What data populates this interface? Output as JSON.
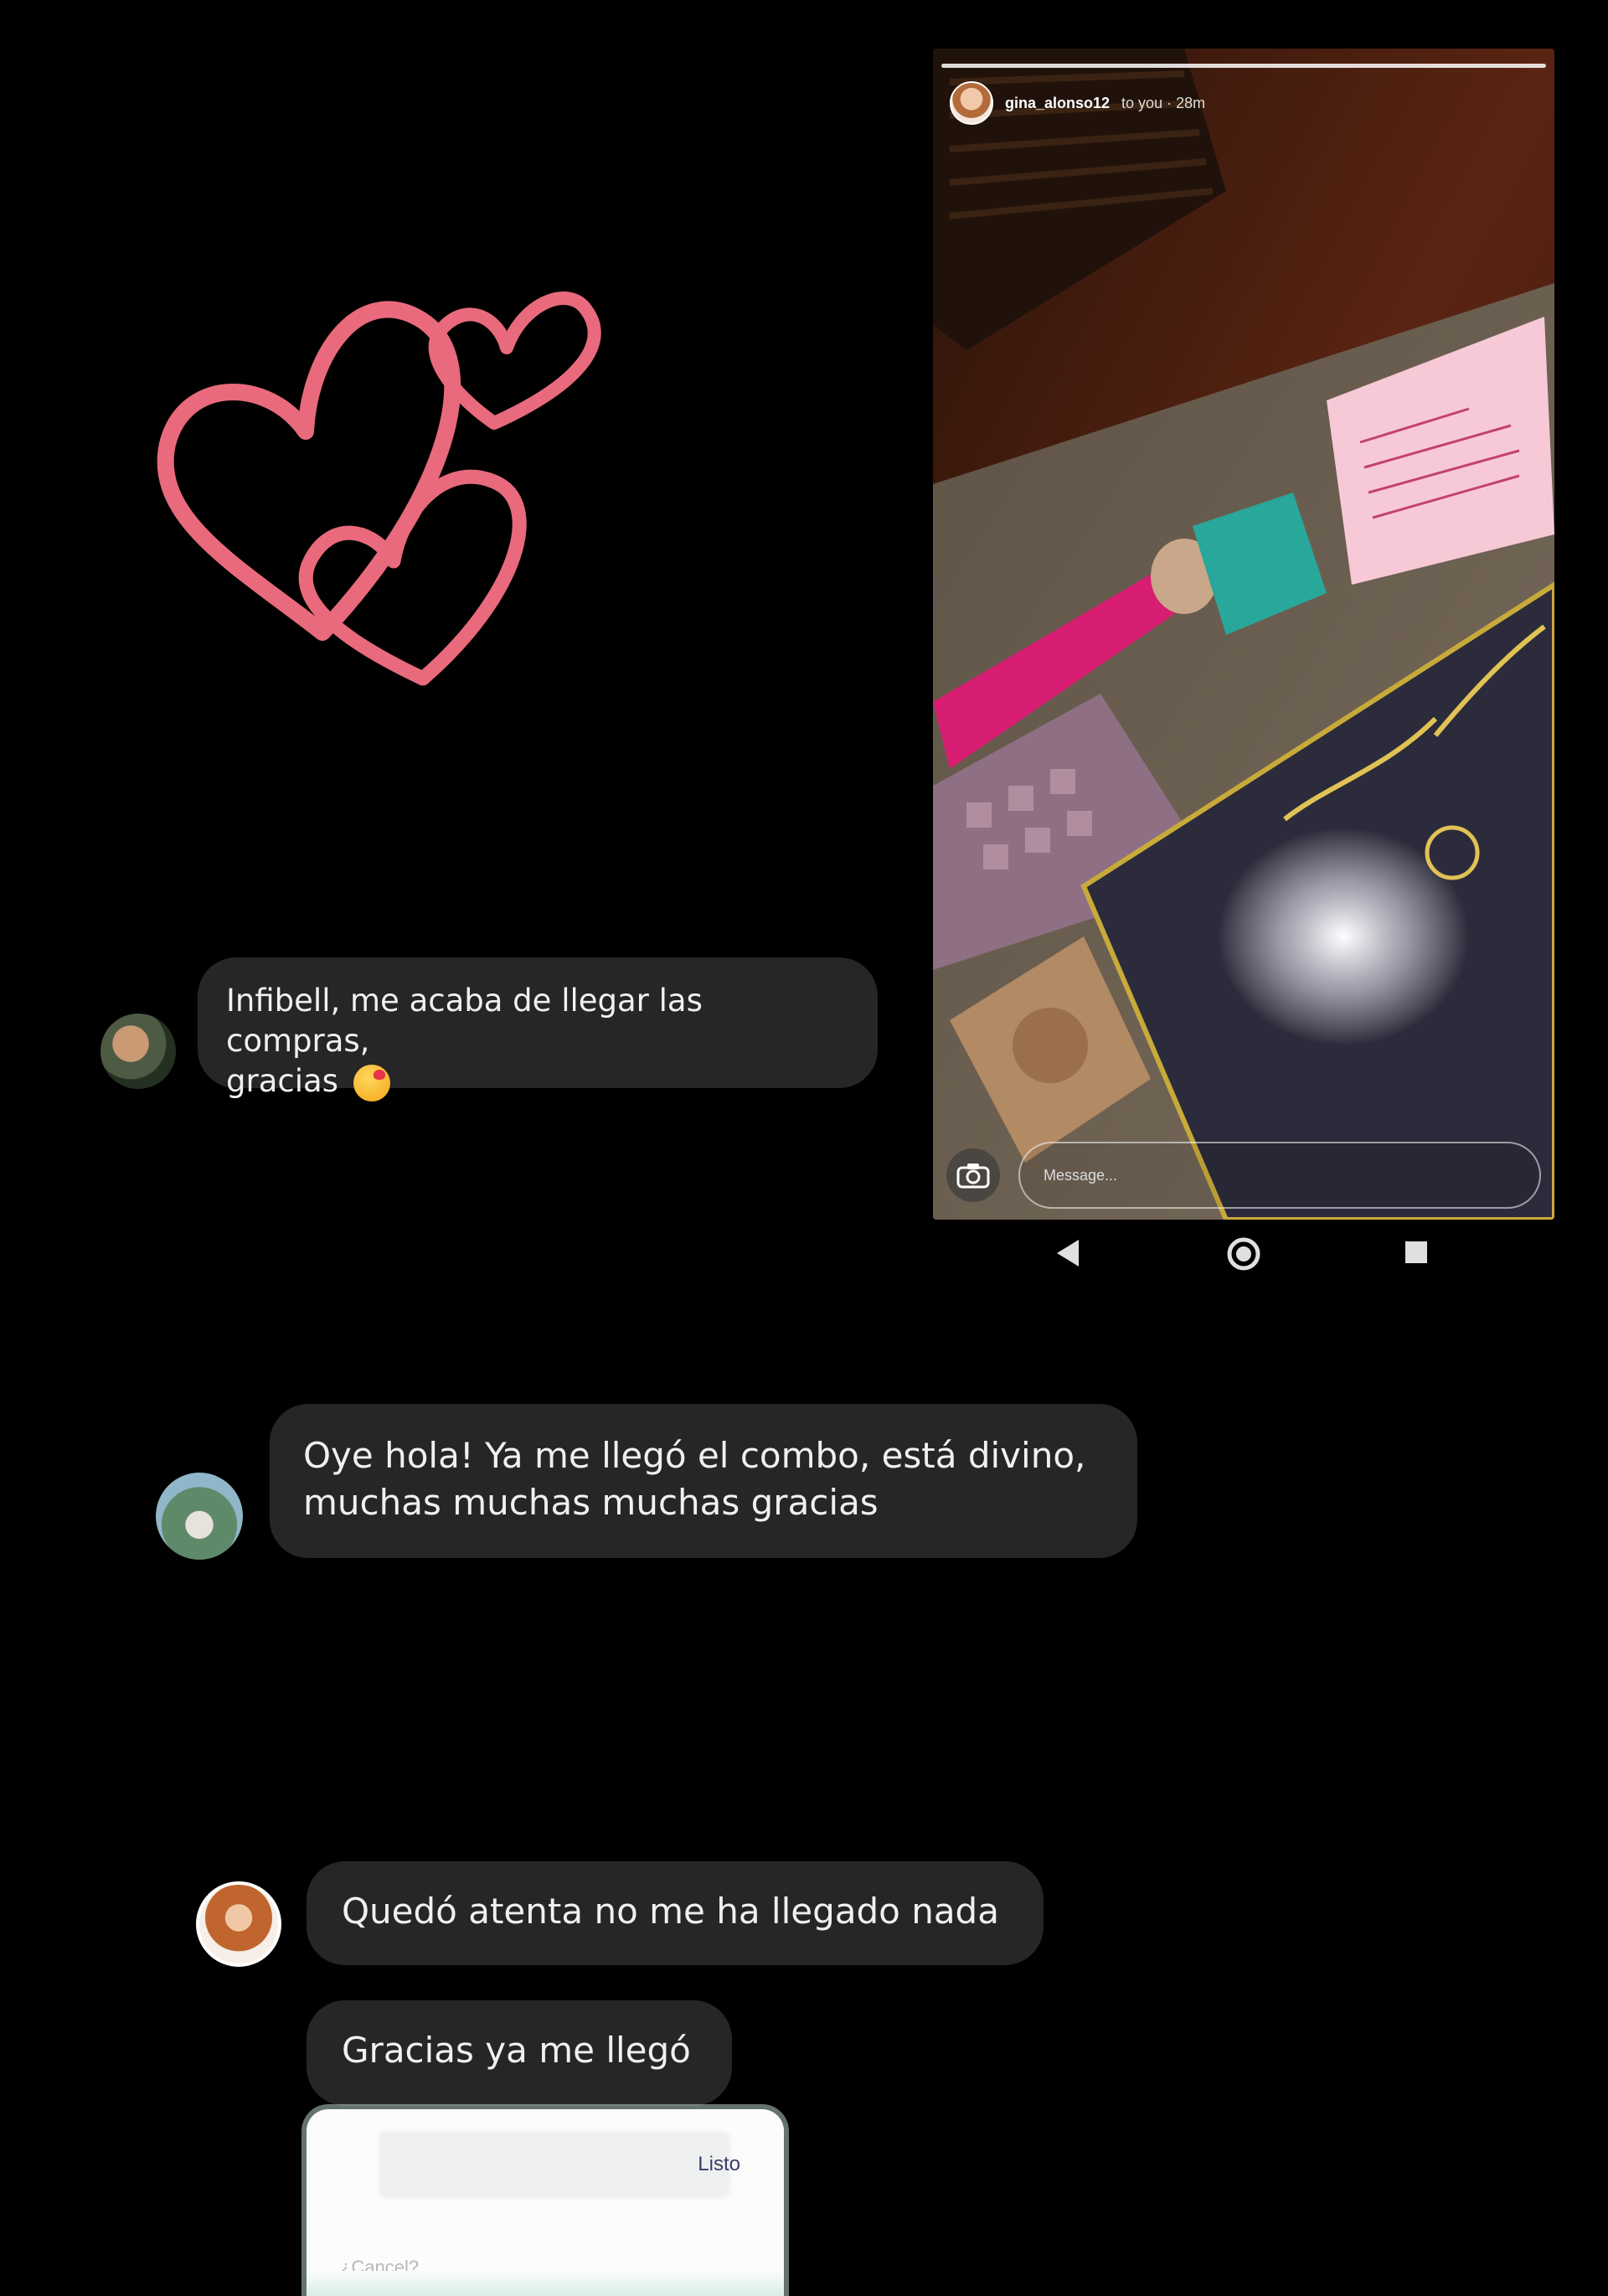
{
  "story": {
    "username": "gina_alonso12",
    "meta": "to you · 28m",
    "message_placeholder": "Message..."
  },
  "messages": [
    {
      "line1": "Infibell, me acaba de llegar las compras,",
      "line2": "gracias",
      "emoji": "kissing-face-emoji"
    },
    {
      "line1": "Oye hola! Ya me llegó el combo, está divino,",
      "line2": "muchas muchas muchas gracias"
    },
    {
      "text": "Quedó atenta no me ha llegado nada"
    },
    {
      "text": "Gracias ya me llegó"
    }
  ],
  "panel": {
    "action_label": "Listo",
    "hint": "¿Cancel?"
  },
  "colors": {
    "background": "#000000",
    "bubble": "#262626",
    "hearts": "#e86a7c"
  },
  "icons": [
    "heart-outline-icon",
    "camera-icon",
    "back-triangle-icon",
    "home-circle-icon",
    "recents-square-icon"
  ]
}
